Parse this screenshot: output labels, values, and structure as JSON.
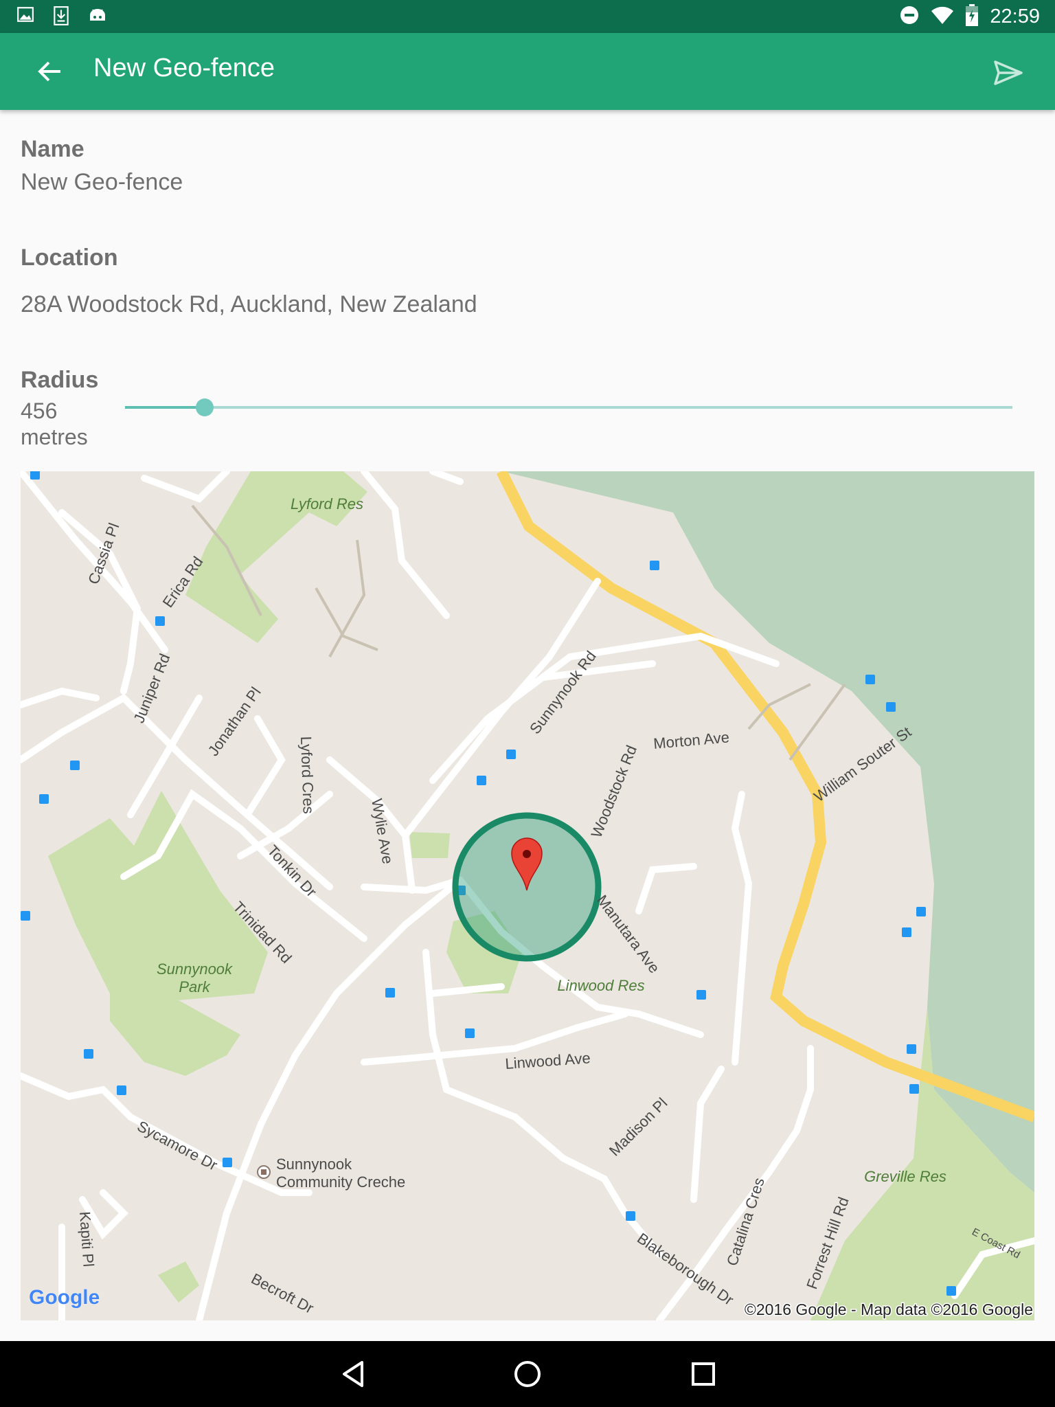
{
  "status_bar": {
    "time": "22:59",
    "left_icons": [
      "image-icon",
      "download-icon",
      "android-icon"
    ],
    "right_icons": [
      "do-not-disturb-icon",
      "wifi-icon",
      "battery-charging-icon"
    ]
  },
  "app_bar": {
    "title": "New Geo-fence",
    "back_icon": "arrow-back-icon",
    "send_icon": "send-icon",
    "color": "#21a577"
  },
  "form": {
    "name_label": "Name",
    "name_value": "New Geo-fence",
    "location_label": "Location",
    "location_value": "28A Woodstock Rd, Auckland, New Zealand",
    "radius_label": "Radius",
    "radius_value": "456",
    "radius_unit": "metres",
    "radius_slider_fraction": 0.09
  },
  "map": {
    "attribution": "©2016 Google - Map data ©2016 Google",
    "logo": "Google",
    "labels": {
      "lyford_res": "Lyford Res",
      "sunnynook_park_1": "Sunnynook",
      "sunnynook_park_2": "Park",
      "linwood_res": "Linwood Res",
      "greville_res": "Greville Res",
      "cassia_pl": "Cassia Pl",
      "erica_rd": "Erica Rd",
      "juniper_rd": "Juniper Rd",
      "jonathan_pl": "Jonathan Pl",
      "lyford_cres": "Lyford Cres",
      "wylie_ave": "Wylie Ave",
      "tonkin_dr": "Tonkin Dr",
      "trinidad_rd": "Trinidad Rd",
      "sunnynook_rd": "Sunnynook Rd",
      "woodstock_rd": "Woodstock Rd",
      "morton_ave": "Morton Ave",
      "william_souter_st": "William Souter St",
      "manutara_ave": "Manutara Ave",
      "linwood_ave": "Linwood Ave",
      "madison_pl": "Madison Pl",
      "catalina_cres": "Catalina Cres",
      "blakeborough_dr": "Blakeborough Dr",
      "forrest_hill_rd": "Forrest Hill Rd",
      "e_coast_rd": "E Coast Rd",
      "sycamore_dr": "Sycamore Dr",
      "creche_1": "Sunnynook",
      "creche_2": "Community Creche",
      "kapiti_pl": "Kapiti Pl",
      "becroft_dr": "Becroft Dr"
    },
    "marker_icon": "map-pin-icon",
    "geofence_color": "#1a8a66"
  },
  "nav_bar": {
    "back_icon": "nav-back-icon",
    "home_icon": "nav-home-icon",
    "recents_icon": "nav-recents-icon"
  }
}
